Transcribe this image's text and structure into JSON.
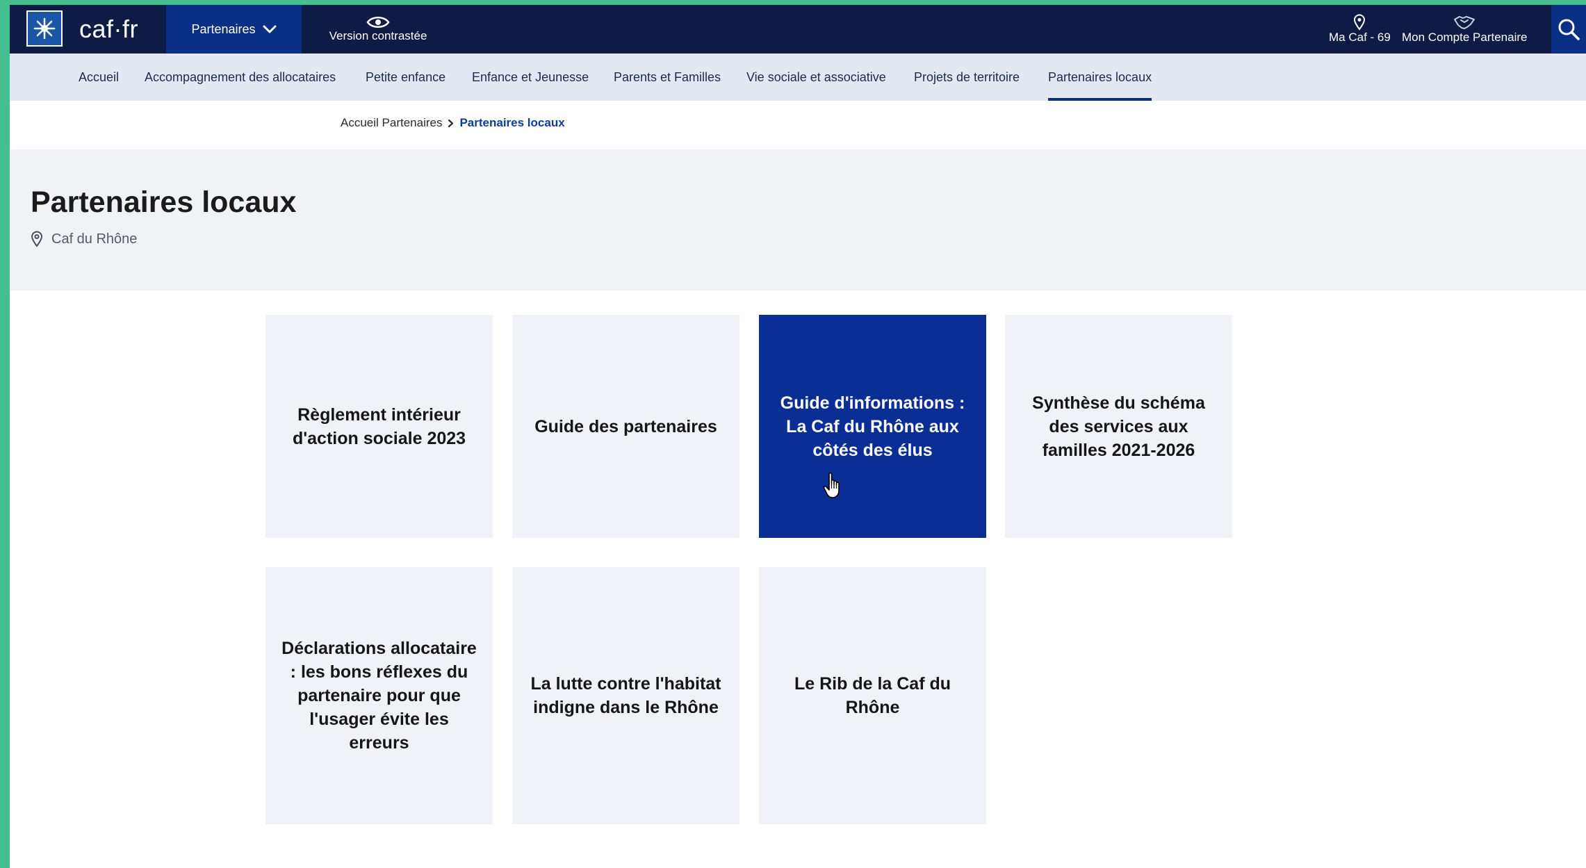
{
  "header": {
    "logo_text": "caf·fr",
    "univers_label": "Partenaires",
    "contrast_label": "Version contrastée",
    "ma_caf_label": "Ma Caf - 69",
    "account_label": "Mon Compte Partenaire",
    "icons": {
      "logo": "caf-logo-icon",
      "univers": "chevron-down-icon",
      "contrast": "eye-icon",
      "ma_caf": "map-pin-icon",
      "account": "handshake-icon",
      "search": "search-icon"
    }
  },
  "nav": {
    "items": [
      {
        "label": "Accueil"
      },
      {
        "label": "Accompagnement des allocataires"
      },
      {
        "label": "Petite enfance"
      },
      {
        "label": "Enfance et Jeunesse"
      },
      {
        "label": "Parents et Familles"
      },
      {
        "label": "Vie sociale et associative"
      },
      {
        "label": "Projets de territoire"
      },
      {
        "label": "Partenaires locaux",
        "active": true
      }
    ]
  },
  "breadcrumb": {
    "home": "Accueil Partenaires",
    "current": "Partenaires locaux"
  },
  "page": {
    "title": "Partenaires locaux",
    "location": "Caf du Rhône"
  },
  "cards": [
    {
      "label": "Règlement intérieur d'action sociale 2023"
    },
    {
      "label": "Guide des partenaires"
    },
    {
      "label": "Guide d'informations : La Caf du Rhône aux côtés des élus",
      "highlighted": true
    },
    {
      "label": "Synthèse du schéma des services aux familles 2021-2026"
    },
    {
      "label": "Déclarations allocataire : les bons réflexes du partenaire pour que l'usager évite les erreurs"
    },
    {
      "label": "La lutte contre l'habitat indigne dans le Rhône"
    },
    {
      "label": "Le Rib de la Caf du Rhône"
    }
  ],
  "colors": {
    "topbar": "#0e1c45",
    "accent": "#0c2f86",
    "highlight_card": "#0a2e94",
    "nav_background": "#e4e8f2",
    "outer_background": "#45be90"
  }
}
